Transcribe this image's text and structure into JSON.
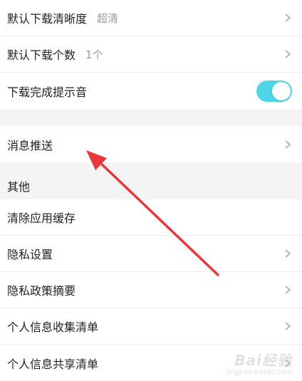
{
  "settings": {
    "download_quality": {
      "label": "默认下载清晰度",
      "value": "超清"
    },
    "download_count": {
      "label": "默认下载个数",
      "value": "1个"
    },
    "download_sound": {
      "label": "下载完成提示音",
      "enabled": true
    },
    "push": {
      "label": "消息推送"
    }
  },
  "other": {
    "header": "其他",
    "clear_cache": "清除应用缓存",
    "privacy_settings": "隐私设置",
    "privacy_summary": "隐私政策摘要",
    "info_collection": "个人信息收集清单",
    "info_sharing": "个人信息共享清单"
  },
  "annotation": {
    "arrow_color": "#e8383d"
  },
  "watermark": {
    "logo": "Bai",
    "logo_tail": "经验",
    "url": "jingyan.baidu.com"
  },
  "colors": {
    "toggle_on": "#4ed6e6",
    "chevron": "#b5b5b5"
  }
}
